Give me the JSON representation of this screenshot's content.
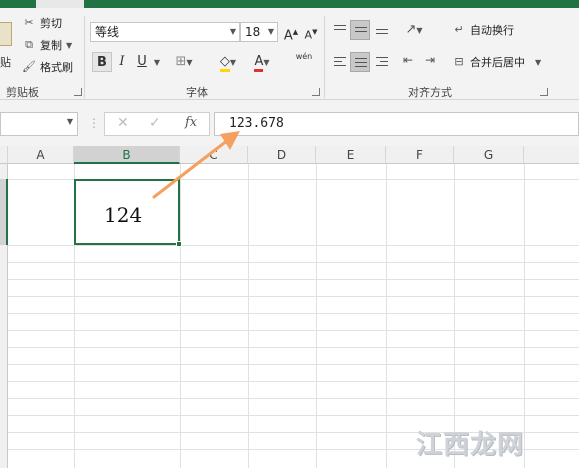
{
  "ribbon": {
    "clipboard": {
      "paste_label": "贴",
      "cut_label": "剪切",
      "copy_label": "复制",
      "format_painter_label": "格式刷",
      "group_label": "剪贴板"
    },
    "font": {
      "font_name": "等线",
      "font_size": "18",
      "grow_label": "A",
      "shrink_label": "A",
      "bold_label": "B",
      "italic_label": "I",
      "underline_label": "U",
      "font_color_label": "A",
      "phonetic_label": "wén",
      "group_label": "字体"
    },
    "alignment": {
      "wrap_text_label": "自动换行",
      "merge_center_label": "合并后居中",
      "group_label": "对齐方式"
    }
  },
  "formula_bar": {
    "name_box_value": "",
    "cancel_symbol": "✕",
    "enter_symbol": "✓",
    "fx_label": "fx",
    "formula_value": "123.678"
  },
  "grid": {
    "columns": [
      "A",
      "B",
      "C",
      "D",
      "E",
      "F",
      "G"
    ],
    "selected_column": "B",
    "active_cell": "B2",
    "active_cell_value": "124"
  },
  "watermark": "江西龙网",
  "colors": {
    "accent": "#217346",
    "arrow": "#f5a05f"
  }
}
